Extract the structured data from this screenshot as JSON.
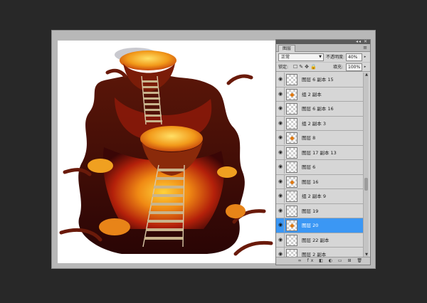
{
  "panel": {
    "tab_label": "图层",
    "menu_icon": "panel-menu-icon",
    "blend_mode": "正常",
    "opacity_label": "不透明度:",
    "opacity_value": "40%",
    "lock_label": "锁定:",
    "fill_label": "填充:",
    "fill_value": "100%",
    "layers": [
      {
        "name": "图层 6 副本 15",
        "visible": true,
        "selected": false
      },
      {
        "name": "组 2 副本",
        "visible": true,
        "selected": false
      },
      {
        "name": "图层 6 副本 16",
        "visible": true,
        "selected": false
      },
      {
        "name": "组 2 副本 3",
        "visible": true,
        "selected": false
      },
      {
        "name": "图层 8",
        "visible": true,
        "selected": false
      },
      {
        "name": "图层 17 副本 13",
        "visible": true,
        "selected": false
      },
      {
        "name": "图层 6",
        "visible": true,
        "selected": false
      },
      {
        "name": "图层 16",
        "visible": true,
        "selected": false
      },
      {
        "name": "组 2 副本 9",
        "visible": true,
        "selected": false
      },
      {
        "name": "图层 19",
        "visible": true,
        "selected": false
      },
      {
        "name": "图层 20",
        "visible": true,
        "selected": true
      },
      {
        "name": "图层 22 副本",
        "visible": true,
        "selected": false
      },
      {
        "name": "图层 2 副本",
        "visible": true,
        "selected": false
      }
    ]
  },
  "colors": {
    "selection": "#3b97f4",
    "panel_bg": "#d6d6d6",
    "workspace": "#282828",
    "lava": "#e07a12"
  }
}
